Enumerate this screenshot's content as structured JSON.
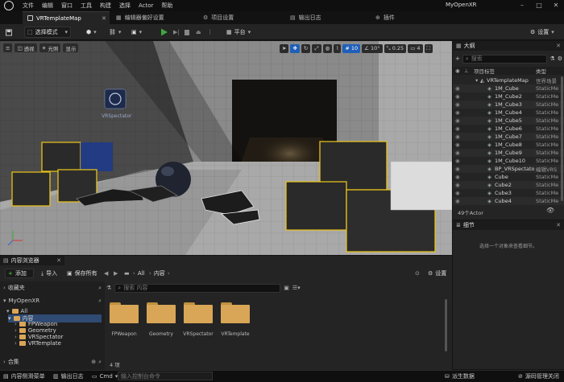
{
  "titlebar": {
    "menu": [
      "文件",
      "编辑",
      "窗口",
      "工具",
      "构建",
      "选择",
      "Actor",
      "帮助"
    ],
    "project_name": "MyOpenXR",
    "tabs": [
      {
        "label": "VRTemplateMap",
        "active": true
      },
      {
        "label": "编辑器偏好设置",
        "active": false
      },
      {
        "label": "项目设置",
        "active": false
      },
      {
        "label": "输出日志",
        "active": false
      },
      {
        "label": "插件",
        "active": false
      }
    ]
  },
  "toolbar": {
    "mode_label": "选择模式",
    "platform_label": "平台",
    "settings_label": "设置"
  },
  "viewport": {
    "perspective_label": "透视",
    "lit_label": "光照",
    "show_label": "显示",
    "grid_snap": "10",
    "rotate_snap": "10°",
    "scale_snap": "0.25",
    "camera_speed": "4",
    "spectator_label": "VRSpectator"
  },
  "outliner": {
    "title": "大纲",
    "search_placeholder": "搜索",
    "col_label": "项目标签",
    "col_type": "类型",
    "root": {
      "name": "VRTemplateMap",
      "type": "世界场景"
    },
    "items": [
      {
        "name": "1M_Cube",
        "type": "StaticMe"
      },
      {
        "name": "1M_Cube2",
        "type": "StaticMe"
      },
      {
        "name": "1M_Cube3",
        "type": "StaticMe"
      },
      {
        "name": "1M_Cube4",
        "type": "StaticMe"
      },
      {
        "name": "1M_Cube5",
        "type": "StaticMe"
      },
      {
        "name": "1M_Cube6",
        "type": "StaticMe"
      },
      {
        "name": "1M_Cube7",
        "type": "StaticMe"
      },
      {
        "name": "1M_Cube8",
        "type": "StaticMe"
      },
      {
        "name": "1M_Cube9",
        "type": "StaticMe"
      },
      {
        "name": "1M_Cube10",
        "type": "StaticMe"
      },
      {
        "name": "BP_VRSpectato",
        "type": "编辑VRS"
      },
      {
        "name": "Cube",
        "type": "StaticMe"
      },
      {
        "name": "Cube2",
        "type": "StaticMe"
      },
      {
        "name": "Cube3",
        "type": "StaticMe"
      },
      {
        "name": "Cube4",
        "type": "StaticMe"
      }
    ],
    "count": "49个Actor"
  },
  "details": {
    "title": "细节",
    "empty_hint": "选择一个对象来查看细节。"
  },
  "content_browser": {
    "title": "内容浏览器",
    "add_label": "添加",
    "import_label": "导入",
    "save_all_label": "保存所有",
    "path_all": "All",
    "path_content": "内容",
    "settings_label": "设置",
    "favorites_label": "收藏夹",
    "project_label": "MyOpenXR",
    "search_placeholder": "搜索 内容",
    "tree": [
      "All",
      "内容",
      "FPWeapon",
      "Geometry",
      "VRSpectator",
      "VRTemplate"
    ],
    "folders": [
      "FPWeapon",
      "Geometry",
      "VRSpectator",
      "VRTemplate"
    ],
    "collections_label": "合集",
    "item_count": "4 项"
  },
  "statusbar": {
    "content_drawer": "内容侧滑菜单",
    "output_log": "输出日志",
    "cmd_label": "Cmd",
    "cmd_placeholder": "输入控制台命令",
    "derived_data": "派生数据",
    "source_control": "源码管理关闭"
  },
  "colors": {
    "accent_blue": "#1f5fb8",
    "play_green": "#3ea83e",
    "folder_gold": "#d9a657",
    "cube_edge_yellow": "#e8c21a"
  }
}
